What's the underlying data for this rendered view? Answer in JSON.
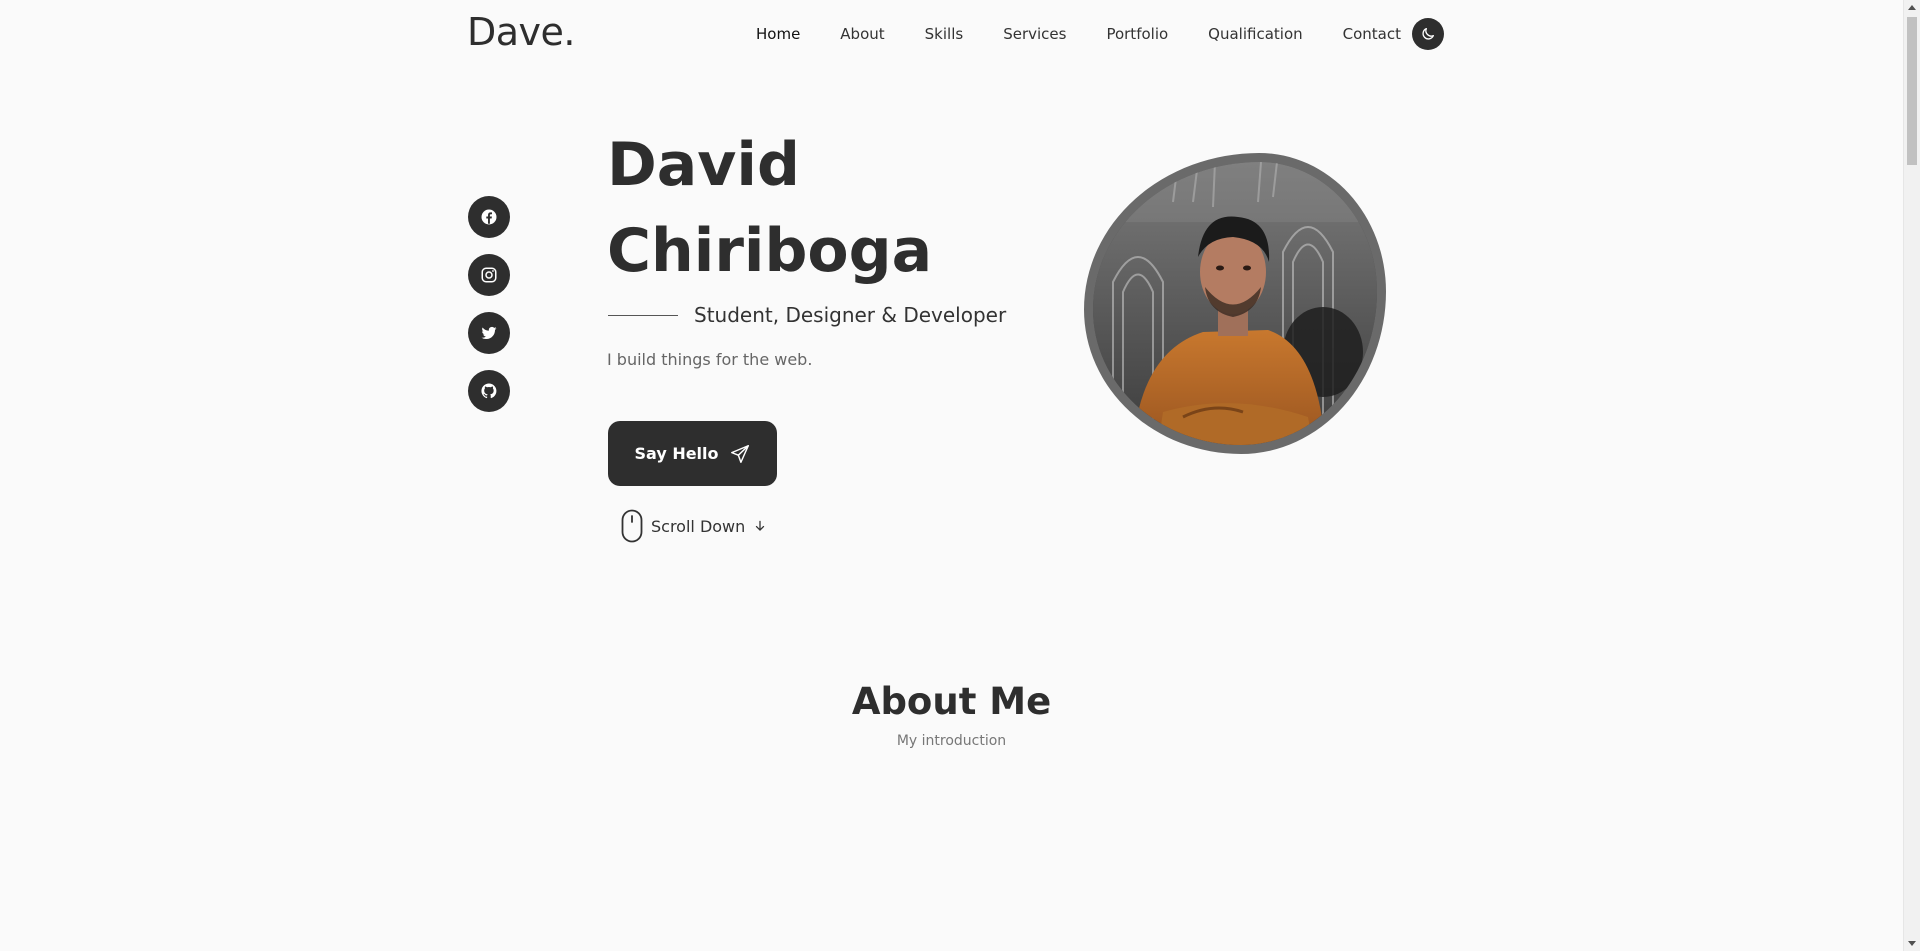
{
  "header": {
    "logo": "Dave.",
    "nav": [
      {
        "label": "Home",
        "active": true
      },
      {
        "label": "About",
        "active": false
      },
      {
        "label": "Skills",
        "active": false
      },
      {
        "label": "Services",
        "active": false
      },
      {
        "label": "Portfolio",
        "active": false
      },
      {
        "label": "Qualification",
        "active": false
      },
      {
        "label": "Contact",
        "active": false
      }
    ],
    "theme_toggle_icon": "moon-icon"
  },
  "social": [
    {
      "name": "facebook",
      "icon": "facebook-icon"
    },
    {
      "name": "instagram",
      "icon": "instagram-icon"
    },
    {
      "name": "twitter",
      "icon": "twitter-icon"
    },
    {
      "name": "github",
      "icon": "github-icon"
    }
  ],
  "hero": {
    "first_name": "David",
    "last_name": "Chiriboga",
    "subtitle": "Student, Designer & Developer",
    "tagline": "I build things for the web.",
    "cta_label": "Say Hello",
    "scroll_label": "Scroll Down"
  },
  "about": {
    "title": "About Me",
    "subtitle": "My introduction"
  },
  "colors": {
    "primary": "#2e2e2e",
    "background": "#fafafa",
    "muted_text": "#666666"
  }
}
